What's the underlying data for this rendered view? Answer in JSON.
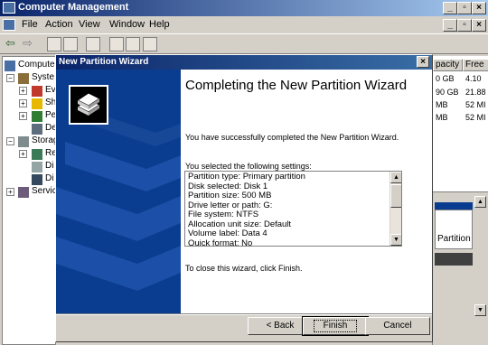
{
  "app": {
    "title": "Computer Management",
    "menu": [
      "File",
      "Action",
      "View",
      "Window",
      "Help"
    ]
  },
  "tree": {
    "items": [
      "Computer",
      "Syste",
      "Ev",
      "Sh",
      "Pe",
      "De",
      "Storag",
      "Re",
      "Di",
      "Di",
      "Servic"
    ]
  },
  "right_pane": {
    "columns": [
      "pacity",
      "Free"
    ],
    "rows": [
      [
        "0 GB",
        "4.10"
      ],
      [
        "90 GB",
        "21.88"
      ],
      [
        "MB",
        "52 MI"
      ],
      [
        "MB",
        "52 MI"
      ]
    ],
    "partition_label": "Partition"
  },
  "dialog": {
    "title": "New Partition Wizard",
    "heading": "Completing the New Partition Wizard",
    "intro": "You have successfully completed the New Partition Wizard.",
    "selected_label": "You selected the following settings:",
    "settings": [
      "Partition type: Primary partition",
      "Disk selected: Disk 1",
      "Partition size: 500 MB",
      "Drive letter or path: G:",
      "File system: NTFS",
      "Allocation unit size: Default",
      "Volume label: Data 4",
      "Quick format: No"
    ],
    "close_message": "To close this wizard, click Finish.",
    "back_label": "< Back",
    "finish_label": "Finish",
    "cancel_label": "Cancel"
  },
  "colors": {
    "titlebar": "#0a246a",
    "banner": "#0a3d8f",
    "face": "#d4d0c8"
  }
}
